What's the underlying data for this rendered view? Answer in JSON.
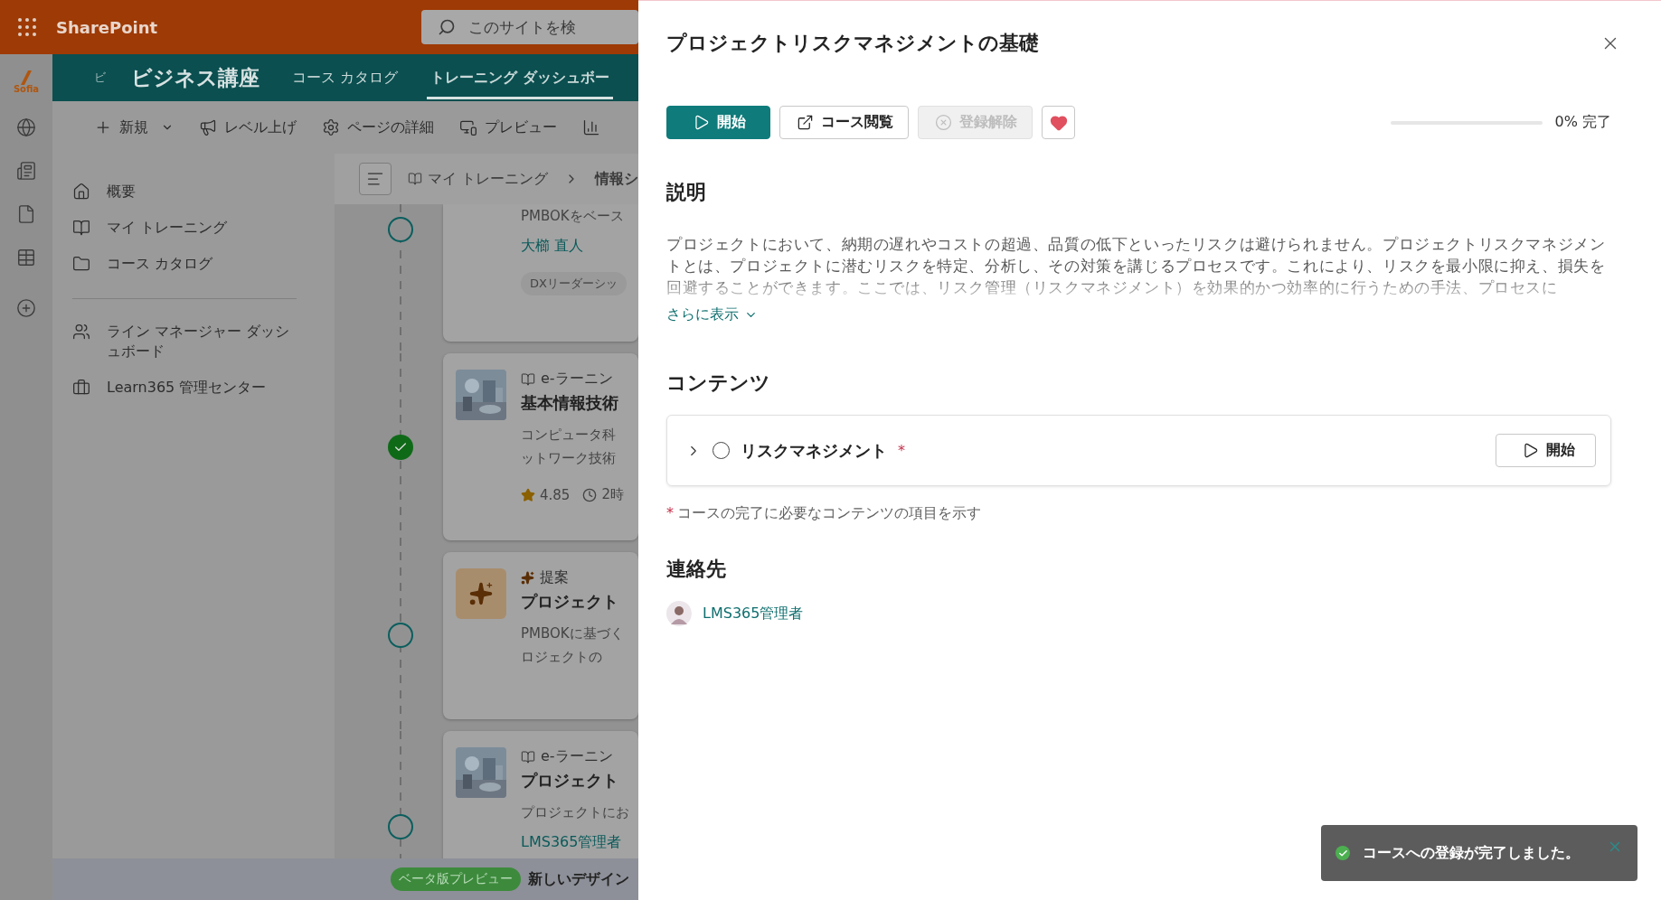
{
  "top_bar": {
    "app_name": "SharePoint",
    "search_placeholder": "このサイトを検"
  },
  "app_rail": {
    "logo_text": "Sofia"
  },
  "site_header": {
    "initial": "ビ",
    "title": "ビジネス講座",
    "nav": [
      {
        "label": "コース カタログ",
        "selected": false
      },
      {
        "label": "トレーニング ダッシュボー",
        "selected": true
      }
    ]
  },
  "command_bar": [
    {
      "label": "新規",
      "kind": "new"
    },
    {
      "label": "レベル上げ",
      "kind": "promote"
    },
    {
      "label": "ページの詳細",
      "kind": "details"
    },
    {
      "label": "プレビュー",
      "kind": "preview"
    },
    {
      "kind": "analytics"
    }
  ],
  "left_nav": {
    "items": [
      {
        "label": "概要",
        "kind": "home"
      },
      {
        "label": "マイ トレーニング",
        "kind": "book"
      },
      {
        "label": "コース カタログ",
        "kind": "folder"
      }
    ],
    "secondary": [
      {
        "label": "ライン マネージャー ダッシュボード",
        "kind": "team"
      },
      {
        "label": "Learn365 管理センター",
        "kind": "admin"
      }
    ]
  },
  "breadcrumb": [
    "マイ トレーニング",
    "情報シ"
  ],
  "feed": [
    {
      "completed": false,
      "media": {
        "kind": "none"
      },
      "description": [
        "PMBOKをベース"
      ],
      "author": "大櫛 直人",
      "tag": "DXリーダーシッ"
    },
    {
      "completed": true,
      "media": {
        "kind": "picture"
      },
      "type": "e-ラーニン",
      "title": "基本情報技術",
      "description": [
        "コンピュータ科",
        "ットワーク技術"
      ],
      "rating": "4.85",
      "duration": "2時"
    },
    {
      "completed": false,
      "media": {
        "kind": "sparkle"
      },
      "type": "提案",
      "title": "プロジェクト",
      "description": [
        "PMBOKに基づく",
        "ロジェクトの"
      ]
    },
    {
      "completed": false,
      "media": {
        "kind": "picture"
      },
      "type": "e-ラーニン",
      "title": "プロジェクト",
      "description": [
        "プロジェクトにお"
      ],
      "author": "LMS365管理者"
    }
  ],
  "beta_bar": {
    "badge": "ベータ版プレビュー",
    "text": "新しいデザイン"
  },
  "panel": {
    "title": "プロジェクトリスクマネジメントの基礎",
    "actions": [
      {
        "label": "開始",
        "kind": "primary",
        "disabled": false
      },
      {
        "label": "コース閲覧",
        "kind": "external",
        "disabled": false
      },
      {
        "label": "登録解除",
        "kind": "unenroll",
        "disabled": true
      }
    ],
    "favorite": true,
    "progress": {
      "level": 0,
      "reading": "0% 完了"
    },
    "description": {
      "heading": "説明",
      "text": "プロジェクトにおいて、納期の遅れやコストの超過、品質の低下といったリスクは避けられません。プロジェクトリスクマネジメントとは、プロジェクトに潜むリスクを特定、分析し、その対策を講じるプロセスです。これにより、リスクを最小限に抑え、損失を回避することができます。ここでは、リスク管理（リスクマネジメント）を効果的かつ効率的に行うための手法、プロセスに",
      "more": "さらに表示"
    },
    "contents": {
      "heading": "コンテンツ",
      "items": [
        {
          "title": "リスクマネジメント",
          "required": true,
          "required_mark": "*",
          "completed": false,
          "expanded": false,
          "action": "開始"
        }
      ],
      "note_mark": "*",
      "note": "コースの完了に必要なコンテンツの項目を示す"
    },
    "contacts": {
      "heading": "連絡先",
      "people": [
        {
          "name": "LMS365管理者"
        }
      ]
    }
  },
  "toast": {
    "kind": "success",
    "message": "コースへの登録が完了しました。"
  }
}
